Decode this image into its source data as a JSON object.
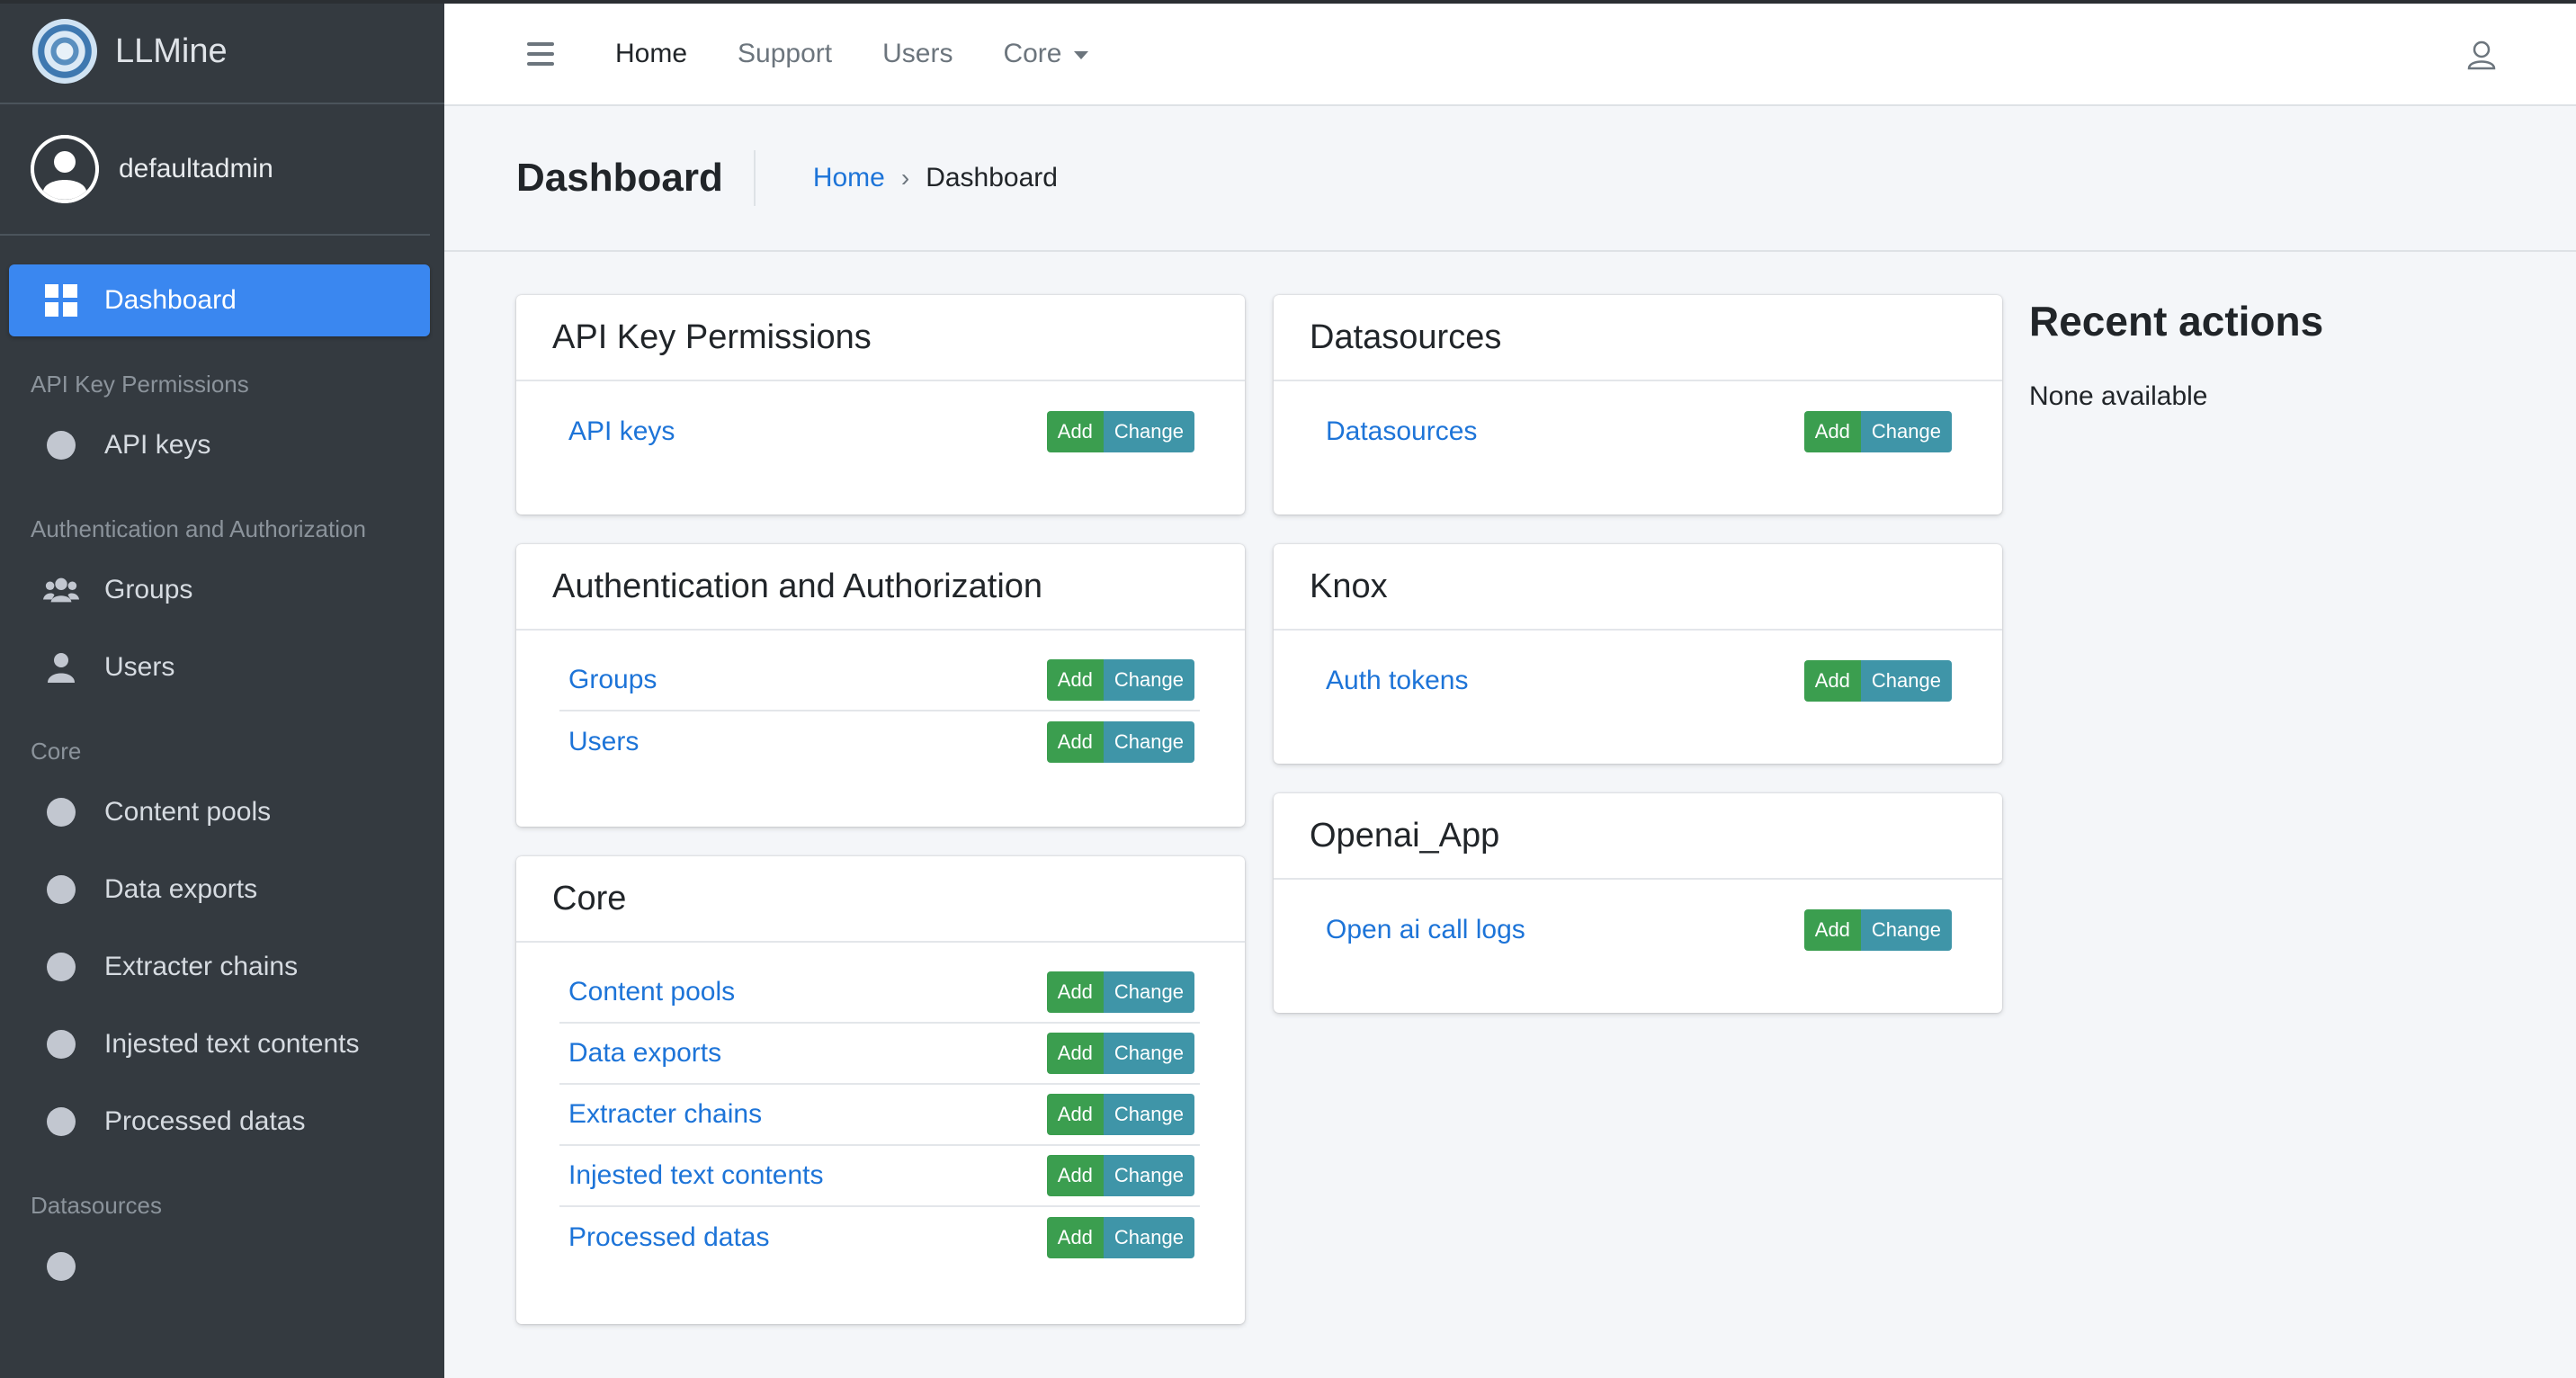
{
  "brand": {
    "name": "LLMine"
  },
  "user": {
    "name": "defaultadmin"
  },
  "sidebar": {
    "dashboard_label": "Dashboard",
    "sections": [
      {
        "header": "API Key Permissions",
        "items": [
          {
            "label": "API keys"
          }
        ]
      },
      {
        "header": "Authentication and Authorization",
        "items": [
          {
            "label": "Groups"
          },
          {
            "label": "Users"
          }
        ]
      },
      {
        "header": "Core",
        "items": [
          {
            "label": "Content pools"
          },
          {
            "label": "Data exports"
          },
          {
            "label": "Extracter chains"
          },
          {
            "label": "Injested text contents"
          },
          {
            "label": "Processed datas"
          }
        ]
      },
      {
        "header": "Datasources",
        "items": []
      }
    ]
  },
  "navbar": {
    "links": [
      "Home",
      "Support",
      "Users",
      "Core"
    ]
  },
  "content_header": {
    "title": "Dashboard",
    "breadcrumb_home": "Home",
    "breadcrumb_separator": "›",
    "breadcrumb_current": "Dashboard"
  },
  "buttons": {
    "add": "Add",
    "change": "Change"
  },
  "cards": {
    "api_key_permissions": {
      "title": "API Key Permissions",
      "models": [
        "API keys"
      ]
    },
    "auth": {
      "title": "Authentication and Authorization",
      "models": [
        "Groups",
        "Users"
      ]
    },
    "core": {
      "title": "Core",
      "models": [
        "Content pools",
        "Data exports",
        "Extracter chains",
        "Injested text contents",
        "Processed datas"
      ]
    },
    "datasources": {
      "title": "Datasources",
      "models": [
        "Datasources"
      ]
    },
    "knox": {
      "title": "Knox",
      "models": [
        "Auth tokens"
      ]
    },
    "openai_app": {
      "title": "Openai_App",
      "models": [
        "Open ai call logs"
      ]
    }
  },
  "recent_actions": {
    "title": "Recent actions",
    "empty_text": "None available"
  },
  "colors": {
    "sidebar_bg": "#343a40",
    "active": "#3a87f0",
    "link": "#1d74d8",
    "add_btn": "#3b9e4f",
    "change_btn": "#3f95a8"
  }
}
